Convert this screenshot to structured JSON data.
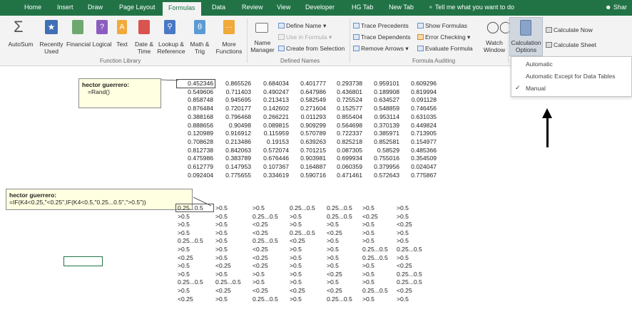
{
  "tabs": [
    "Home",
    "Insert",
    "Draw",
    "Page Layout",
    "Formulas",
    "Data",
    "Review",
    "View",
    "Developer",
    "HG Tab",
    "New Tab"
  ],
  "active_tab": "Formulas",
  "tell_me": "Tell me what you want to do",
  "share": "Shar",
  "ribbon": {
    "function_library": {
      "autosum": "AutoSum",
      "recently_used": "Recently\nUsed",
      "financial": "Financial",
      "logical": "Logical",
      "text": "Text",
      "date_time": "Date &\nTime",
      "lookup_reference": "Lookup &\nReference",
      "math_trig": "Math &\nTrig",
      "more_functions": "More\nFunctions",
      "group_label": "Function Library"
    },
    "defined_names": {
      "name_manager": "Name\nManager",
      "define_name": "Define Name",
      "use_in_formula": "Use in Formula",
      "create_from_selection": "Create from Selection",
      "group_label": "Defined Names"
    },
    "formula_auditing": {
      "trace_precedents": "Trace Precedents",
      "trace_dependents": "Trace Dependents",
      "remove_arrows": "Remove Arrows",
      "show_formulas": "Show Formulas",
      "error_checking": "Error Checking",
      "evaluate_formula": "Evaluate Formula",
      "watch_window": "Watch\nWindow",
      "group_label": "Formula Auditing"
    },
    "calculation": {
      "calculation_options": "Calculation\nOptions",
      "calculate_now": "Calculate Now",
      "calculate_sheet": "Calculate Sheet"
    }
  },
  "calc_menu": {
    "items": [
      "Automatic",
      "Automatic Except for Data Tables",
      "Manual"
    ],
    "checked": "Manual"
  },
  "comments": [
    {
      "author": "hector guerrero:",
      "text": "=Rand()"
    },
    {
      "author": "hector guerrero:",
      "text": "=IF(K4<0.25,\"<0.25\",IF(K4<0.5,\"0.25...0.5\",\">0.5\"))"
    }
  ],
  "rand_table": [
    [
      "0.452346",
      "0.865526",
      "0.684034",
      "0.401777",
      "0.293738",
      "0.959101",
      "0.609296"
    ],
    [
      "0.549606",
      "0.711403",
      "0.490247",
      "0.647986",
      "0.436801",
      "0.189908",
      "0.819994"
    ],
    [
      "0.858748",
      "0.945695",
      "0.213413",
      "0.582549",
      "0.725524",
      "0.634527",
      "0.091128"
    ],
    [
      "0.876484",
      "0.720177",
      "0.142602",
      "0.271604",
      "0.152577",
      "0.548859",
      "0.746456"
    ],
    [
      "0.388168",
      "0.796468",
      "0.266221",
      "0.011293",
      "0.855404",
      "0.953114",
      "0.631035"
    ],
    [
      "0.888656",
      "0.90498",
      "0.089815",
      "0.909299",
      "0.564698",
      "0.370139",
      "0.449824"
    ],
    [
      "0.120989",
      "0.916912",
      "0.115959",
      "0.570789",
      "0.722337",
      "0.385971",
      "0.713905"
    ],
    [
      "0.708628",
      "0.213486",
      "0.19153",
      "0.639263",
      "0.825218",
      "0.852581",
      "0.154977"
    ],
    [
      "0.812738",
      "0.842063",
      "0.572074",
      "0.701215",
      "0.087305",
      "0.58529",
      "0.485366"
    ],
    [
      "0.475986",
      "0.383789",
      "0.676446",
      "0.903981",
      "0.699934",
      "0.755016",
      "0.354509"
    ],
    [
      "0.612779",
      "0.147953",
      "0.107367",
      "0.164887",
      "0.060359",
      "0.379956",
      "0.024047"
    ],
    [
      "0.092404",
      "0.775655",
      "0.334619",
      "0.590716",
      "0.471461",
      "0.572643",
      "0.775867"
    ]
  ],
  "cat_table": [
    [
      "0.25...0.5",
      ">0.5",
      ">0.5",
      "0.25...0.5",
      "0.25...0.5",
      ">0.5",
      ">0.5"
    ],
    [
      ">0.5",
      ">0.5",
      "0.25...0.5",
      ">0.5",
      "0.25...0.5",
      "<0.25",
      ">0.5"
    ],
    [
      ">0.5",
      ">0.5",
      "<0.25",
      ">0.5",
      ">0.5",
      ">0.5",
      "<0.25"
    ],
    [
      ">0.5",
      ">0.5",
      "<0.25",
      "0.25...0.5",
      "<0.25",
      ">0.5",
      ">0.5"
    ],
    [
      "0.25...0.5",
      ">0.5",
      "0.25...0.5",
      "<0.25",
      ">0.5",
      ">0.5",
      ">0.5"
    ],
    [
      ">0.5",
      ">0.5",
      "<0.25",
      ">0.5",
      ">0.5",
      "0.25...0.5",
      "0.25...0.5"
    ],
    [
      "<0.25",
      ">0.5",
      "<0.25",
      ">0.5",
      ">0.5",
      "0.25...0.5",
      ">0.5"
    ],
    [
      ">0.5",
      "<0.25",
      "<0.25",
      ">0.5",
      ">0.5",
      ">0.5",
      "<0.25"
    ],
    [
      ">0.5",
      ">0.5",
      ">0.5",
      ">0.5",
      "<0.25",
      ">0.5",
      "0.25...0.5"
    ],
    [
      "0.25...0.5",
      "0.25...0.5",
      ">0.5",
      ">0.5",
      ">0.5",
      ">0.5",
      "0.25...0.5"
    ],
    [
      ">0.5",
      "<0.25",
      "<0.25",
      "<0.25",
      "<0.25",
      "0.25...0.5",
      "<0.25"
    ],
    [
      "<0.25",
      ">0.5",
      "0.25...0.5",
      ">0.5",
      "0.25...0.5",
      ">0.5",
      ">0.5"
    ]
  ]
}
